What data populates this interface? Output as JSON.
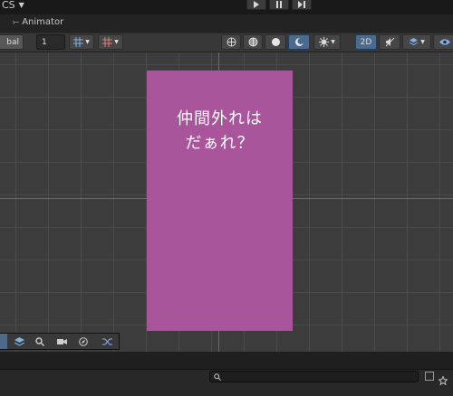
{
  "top_bar": {
    "left_fragment": "CS",
    "play_buttons": [
      "play-icon",
      "pause-icon",
      "step-icon"
    ]
  },
  "tab": {
    "label": "Animator",
    "icon": "animator-icon"
  },
  "toolbar": {
    "dropdown_label": "bal",
    "number_value": "1",
    "mode_2d_label": "2D",
    "icons": [
      "grid-snap-icon",
      "increment-snap-icon",
      "wireframe-globe-icon",
      "shaded-sphere-icon",
      "solid-circle-icon",
      "lighting-icon",
      "effects-icon",
      "toggle-2d-button",
      "audio-mute-icon",
      "gizmos-icon",
      "visibility-icon"
    ]
  },
  "card": {
    "line1": "仲間外れは",
    "line2": "だぁれ？",
    "color": "#a9559c"
  },
  "overlay_tools": [
    "view-tool-icon",
    "layers-icon",
    "search-icon",
    "camera-tool-icon",
    "compass-icon",
    "shuffle-icon"
  ],
  "colors": {
    "accent": "#4a6a8e",
    "background": "#3b3b3b"
  }
}
